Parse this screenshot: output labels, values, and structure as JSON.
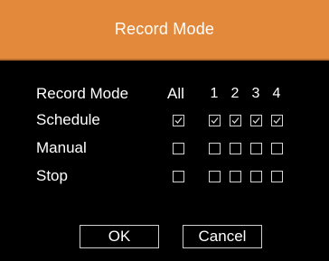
{
  "dialog": {
    "title": "Record Mode"
  },
  "header": {
    "mode_label": "Record Mode",
    "all_label": "All",
    "channels": [
      "1",
      "2",
      "3",
      "4"
    ]
  },
  "rows": [
    {
      "label": "Schedule",
      "all": true,
      "channels": [
        true,
        true,
        true,
        true
      ]
    },
    {
      "label": "Manual",
      "all": false,
      "channels": [
        false,
        false,
        false,
        false
      ]
    },
    {
      "label": "Stop",
      "all": false,
      "channels": [
        false,
        false,
        false,
        false
      ]
    }
  ],
  "buttons": {
    "ok": "OK",
    "cancel": "Cancel"
  },
  "colors": {
    "title_bar": "#e3893b",
    "background": "#000000",
    "text": "#ffffff"
  }
}
